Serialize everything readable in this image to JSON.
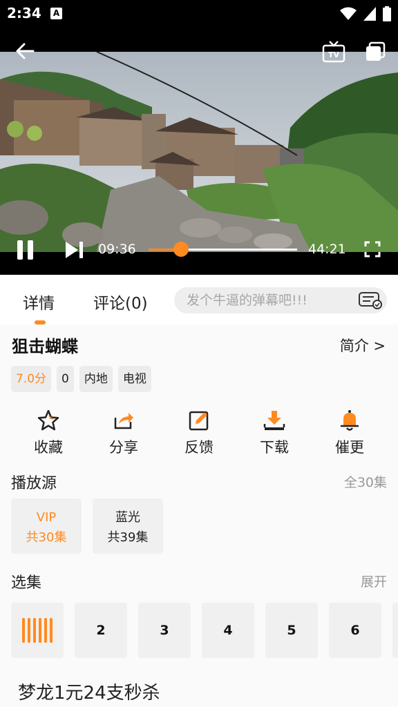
{
  "status_bar": {
    "time": "2:34",
    "notif_letter": "A"
  },
  "player": {
    "current_time": "09:36",
    "duration": "44:21",
    "progress": 0.217
  },
  "tabs": [
    {
      "label": "详情"
    },
    {
      "label": "评论(0)"
    }
  ],
  "danmaku": {
    "placeholder": "发个牛逼的弹幕吧!!!"
  },
  "show": {
    "title": "狙击蝴蝶",
    "intro_label": "简介 >",
    "tags": [
      "7.0分",
      "0",
      "内地",
      "电视"
    ]
  },
  "actions": [
    {
      "label": "收藏",
      "icon": "star-icon"
    },
    {
      "label": "分享",
      "icon": "share-icon"
    },
    {
      "label": "反馈",
      "icon": "edit-icon"
    },
    {
      "label": "下载",
      "icon": "download-icon"
    },
    {
      "label": "催更",
      "icon": "bell-icon"
    }
  ],
  "sources_section": {
    "title": "播放源",
    "extra": "全30集",
    "items": [
      {
        "name": "VIP",
        "count": "共30集"
      },
      {
        "name": "蓝光",
        "count": "共39集"
      }
    ]
  },
  "episodes_section": {
    "title": "选集",
    "extra": "展开",
    "items": [
      "2",
      "3",
      "4",
      "5",
      "6"
    ]
  },
  "promo": {
    "text": "梦龙1元24支秒杀"
  },
  "colors": {
    "accent": "#ff8a1f"
  }
}
